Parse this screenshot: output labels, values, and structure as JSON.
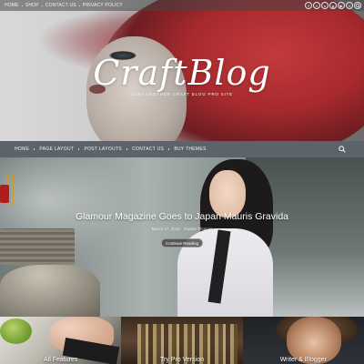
{
  "top_nav": {
    "items": [
      "HOME",
      "SHOP",
      "CONTACT US",
      "PRIVACY POLICY"
    ],
    "social_icons": [
      "facebook-icon",
      "twitter-icon",
      "vimeo-icon",
      "google-plus-icon",
      "youtube-icon",
      "tumblr-icon",
      "search-icon"
    ]
  },
  "header": {
    "logo": "CraftBlog",
    "tagline": "JUST ANOTHER CRAFT BLOG PRO SITE"
  },
  "main_nav": {
    "items": [
      "HOME",
      "PAGE LAYOUT",
      "POST LAYOUTS",
      "CONTACT US",
      "BUY THEMES"
    ]
  },
  "hero": {
    "title": "Glamour Magazine Goes to Japan Mauris Gravida",
    "meta": "March 17, 2015 · Sophie Thomas",
    "button": "Continue Reading"
  },
  "features": [
    {
      "label": "All Features"
    },
    {
      "label": "Try Pro Version"
    },
    {
      "label": "Writer & Blogger"
    }
  ],
  "colors": {
    "main_nav_bg": "#5c636b",
    "hair_red": "#c23a3d"
  }
}
